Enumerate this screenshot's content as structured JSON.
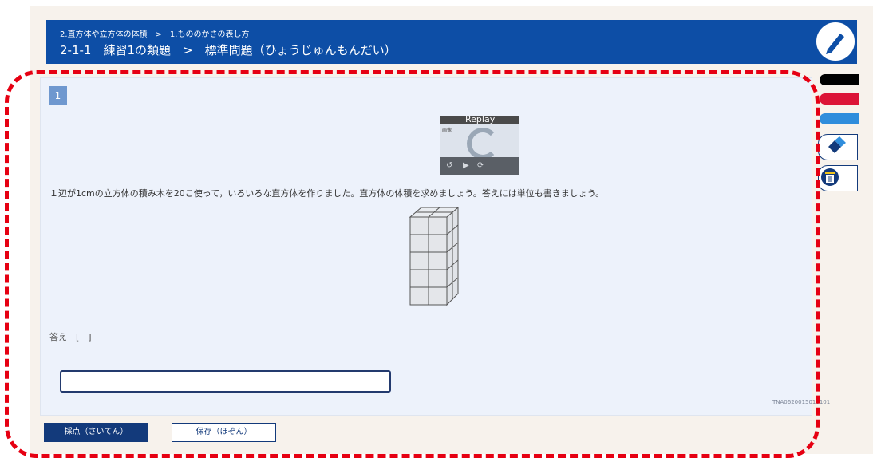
{
  "header": {
    "breadcrumb": "2.直方体や立方体の体積　>　1.もののかさの表し方",
    "title": "2-1-1　練習1の類題　>　標準問題（ひょうじゅんもんだい）",
    "pencil_icon": "pencil-icon"
  },
  "question": {
    "number": "1",
    "video": {
      "replay_label": "Replay",
      "thumb_text": "画像",
      "controls": [
        "↺",
        "▶",
        "⟳"
      ]
    },
    "text": "１辺が1cmの立方体の積み木を20こ使って，いろいろな直方体を作りました。直方体の体積を求めましょう。答えには単位も書きましょう。",
    "figure_icon": "cube-stack-figure",
    "answer_label": "答え　[　]",
    "answer_value": "",
    "code": "TNA0620015010101"
  },
  "actions": {
    "score_label": "採点（さいてん）",
    "save_label": "保存（ほぞん）"
  },
  "tools": {
    "pens": [
      {
        "name": "black-pen",
        "color": "#000000"
      },
      {
        "name": "red-pen",
        "color": "#dc1436"
      },
      {
        "name": "blue-pen",
        "color": "#2f8ddc"
      }
    ],
    "eraser_icon": "eraser-icon",
    "trash_icon": "trash-icon"
  },
  "colors": {
    "header": "#0d4ea6",
    "highlight_frame": "#e60012",
    "button": "#133a7b"
  }
}
